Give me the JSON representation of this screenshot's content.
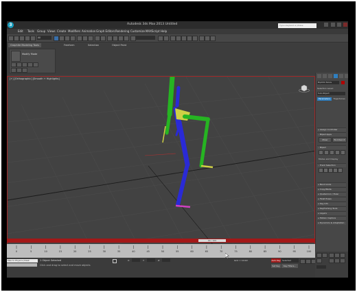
{
  "app": {
    "title": "Autodesk 3ds Max 2013     Untitled",
    "search_placeholder": "Type a keyword or phrase",
    "logo_letter": "3"
  },
  "menu": [
    "Edit",
    "Tools",
    "Group",
    "Views",
    "Create",
    "Modifiers",
    "Animation",
    "Graph Editors",
    "Rendering",
    "Customize",
    "MAXScript",
    "Help"
  ],
  "toolbar": {
    "selection_filter": "All"
  },
  "ribbon": {
    "tabs": [
      "Graphite Modeling Tools",
      "Freeform",
      "Selection",
      "Object Paint"
    ],
    "panel_button": "Modify Mode",
    "footer_label": "Polygon Modeling ▾"
  },
  "viewport": {
    "label": "[+] [Orthographic] [Smooth + Highlights]"
  },
  "command_panel": {
    "object_name": "Bip001 Pelvis",
    "selection_level": "Selection Level:",
    "sub_level": "Sub-Object",
    "tab_parameters": "Parameters",
    "tab_trajectories": "Trajectories",
    "assign_controller": "Assign Controller",
    "biped_apps": "Biped Apps",
    "mixer_btn": "Mixer",
    "workbench_btn": "Workbench",
    "biped_header": "Biped",
    "modes_label": "Modes and Display",
    "track_selection": "Track Selection",
    "rollouts": [
      "Bend Links",
      "Copy/Paste",
      "Quaternion / Euler",
      "Twist Poses",
      "Key Info",
      "Keyframing Tools",
      "Layers",
      "Motion Capture",
      "Dynamics & Adaptation"
    ]
  },
  "timeline": {
    "frame_counter": "40 / 100",
    "tick_labels": [
      "0",
      "5",
      "10",
      "15",
      "20",
      "25",
      "30",
      "35",
      "40",
      "45",
      "50",
      "55",
      "60",
      "65",
      "70",
      "75",
      "80",
      "85",
      "90",
      "95",
      "100"
    ]
  },
  "status": {
    "maxscript_label": "Max to Physics (Desk",
    "selection_status": "1 Object Selected",
    "prompt": "Click and drag to select and move objects",
    "x_label": "X:",
    "y_label": "Y:",
    "z_label": "Z:",
    "grid": "Grid = 10.0m",
    "auto_key": "Auto Key",
    "selected": "Selected",
    "set_key": "Set Key",
    "key_filters": "Key Filters..."
  },
  "colors": {
    "accent_blue": "#2f7fc0",
    "viewport_border": "#a12828",
    "timeslider_red": "#a31818",
    "biped_green": "#26b422",
    "biped_blue": "#2a2ad6",
    "biped_yellow": "#cfd045"
  },
  "icons": [
    "app-logo-icon",
    "select-icon",
    "move-icon",
    "rotate-icon",
    "scale-icon",
    "view-cube-icon",
    "lock-icon",
    "play-icon",
    "cursor-icon"
  ]
}
